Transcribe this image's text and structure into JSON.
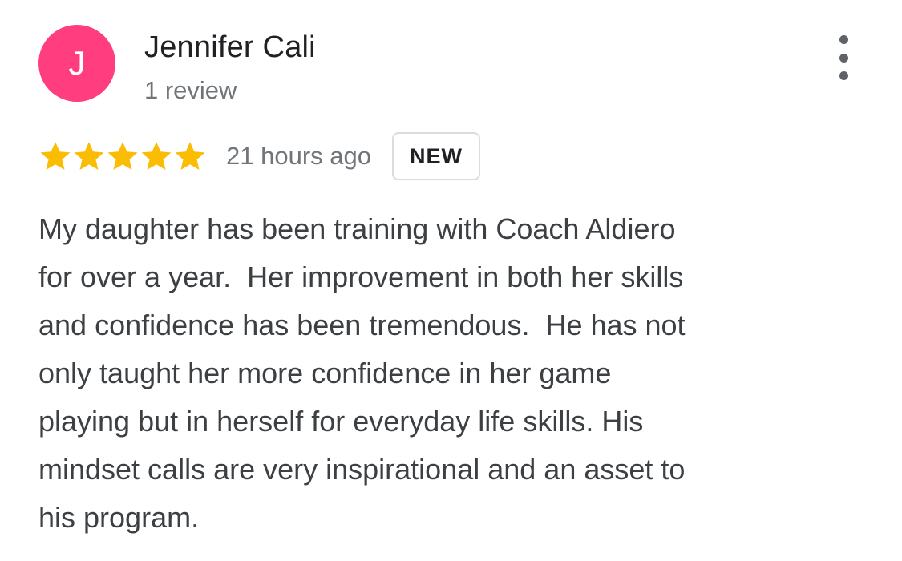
{
  "reviewer": {
    "initial": "J",
    "avatar_color": "#ff3d7f",
    "name": "Jennifer Cali",
    "review_count": "1 review"
  },
  "menu": {
    "icon": "more-vert-icon"
  },
  "rating": {
    "stars": 5,
    "max": 5,
    "star_color": "#fbbc04",
    "timestamp": "21 hours ago",
    "badge": "NEW"
  },
  "review": {
    "lines": [
      "My daughter has been training with Coach Aldiero",
      "for over a year.  Her improvement in both her skills",
      "and confidence has been tremendous.  He has not",
      "only taught her more confidence in her game",
      "playing but in herself for everyday life skills. His",
      "mindset calls are very inspirational and an asset to",
      "his program."
    ]
  }
}
